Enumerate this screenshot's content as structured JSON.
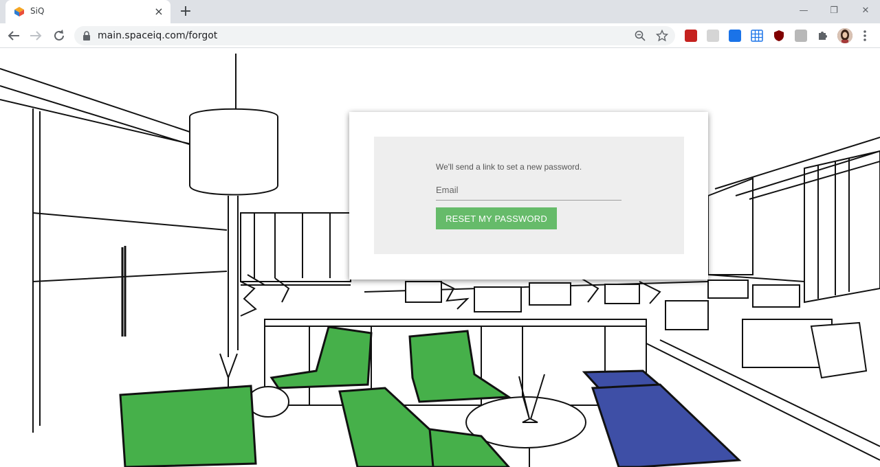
{
  "browser": {
    "tab_title": "SiQ",
    "tab_close": "×",
    "new_tab": "+",
    "url": "main.spaceiq.com/forgot",
    "window_controls": {
      "minimize": "—",
      "restore": "❐",
      "close": "✕"
    }
  },
  "form": {
    "helper_text": "We'll send a link to set a new password.",
    "email_placeholder": "Email",
    "email_value": "",
    "submit_label": "RESET MY PASSWORD"
  },
  "colors": {
    "button": "#66bb6a",
    "chair_green": "#46b04a",
    "bench_blue": "#3e4fa6",
    "panel": "#eeeeee"
  },
  "icons": [
    "back-arrow-icon",
    "forward-arrow-icon",
    "reload-icon",
    "lock-icon",
    "zoom-icon",
    "star-icon",
    "pdf-extension-icon",
    "reader-extension-icon",
    "translate-extension-icon",
    "grid-extension-icon",
    "ublock-extension-icon",
    "image-extension-icon",
    "puzzle-extension-icon",
    "menu-dots-icon"
  ]
}
